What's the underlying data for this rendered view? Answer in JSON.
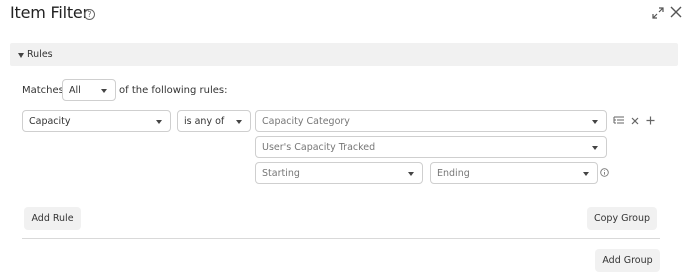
{
  "header": {
    "title": "Item Filter",
    "help_glyph": "?",
    "expand_icon": "expand-icon",
    "close_icon": "close-icon"
  },
  "rules_section": {
    "label": "Rules",
    "caret_icon": "caret-down-icon",
    "matches_prefix": "Matches",
    "matches_value": "All",
    "matches_suffix": "of the following rules:",
    "rule": {
      "field_value": "Capacity",
      "operator_value": "is any of",
      "category_placeholder": "Capacity Category",
      "tracked_placeholder": "User's Capacity Tracked",
      "starting_placeholder": "Starting",
      "ending_placeholder": "Ending"
    },
    "buttons": {
      "add_rule": "Add Rule",
      "copy_group": "Copy Group",
      "add_group": "Add Group"
    }
  }
}
